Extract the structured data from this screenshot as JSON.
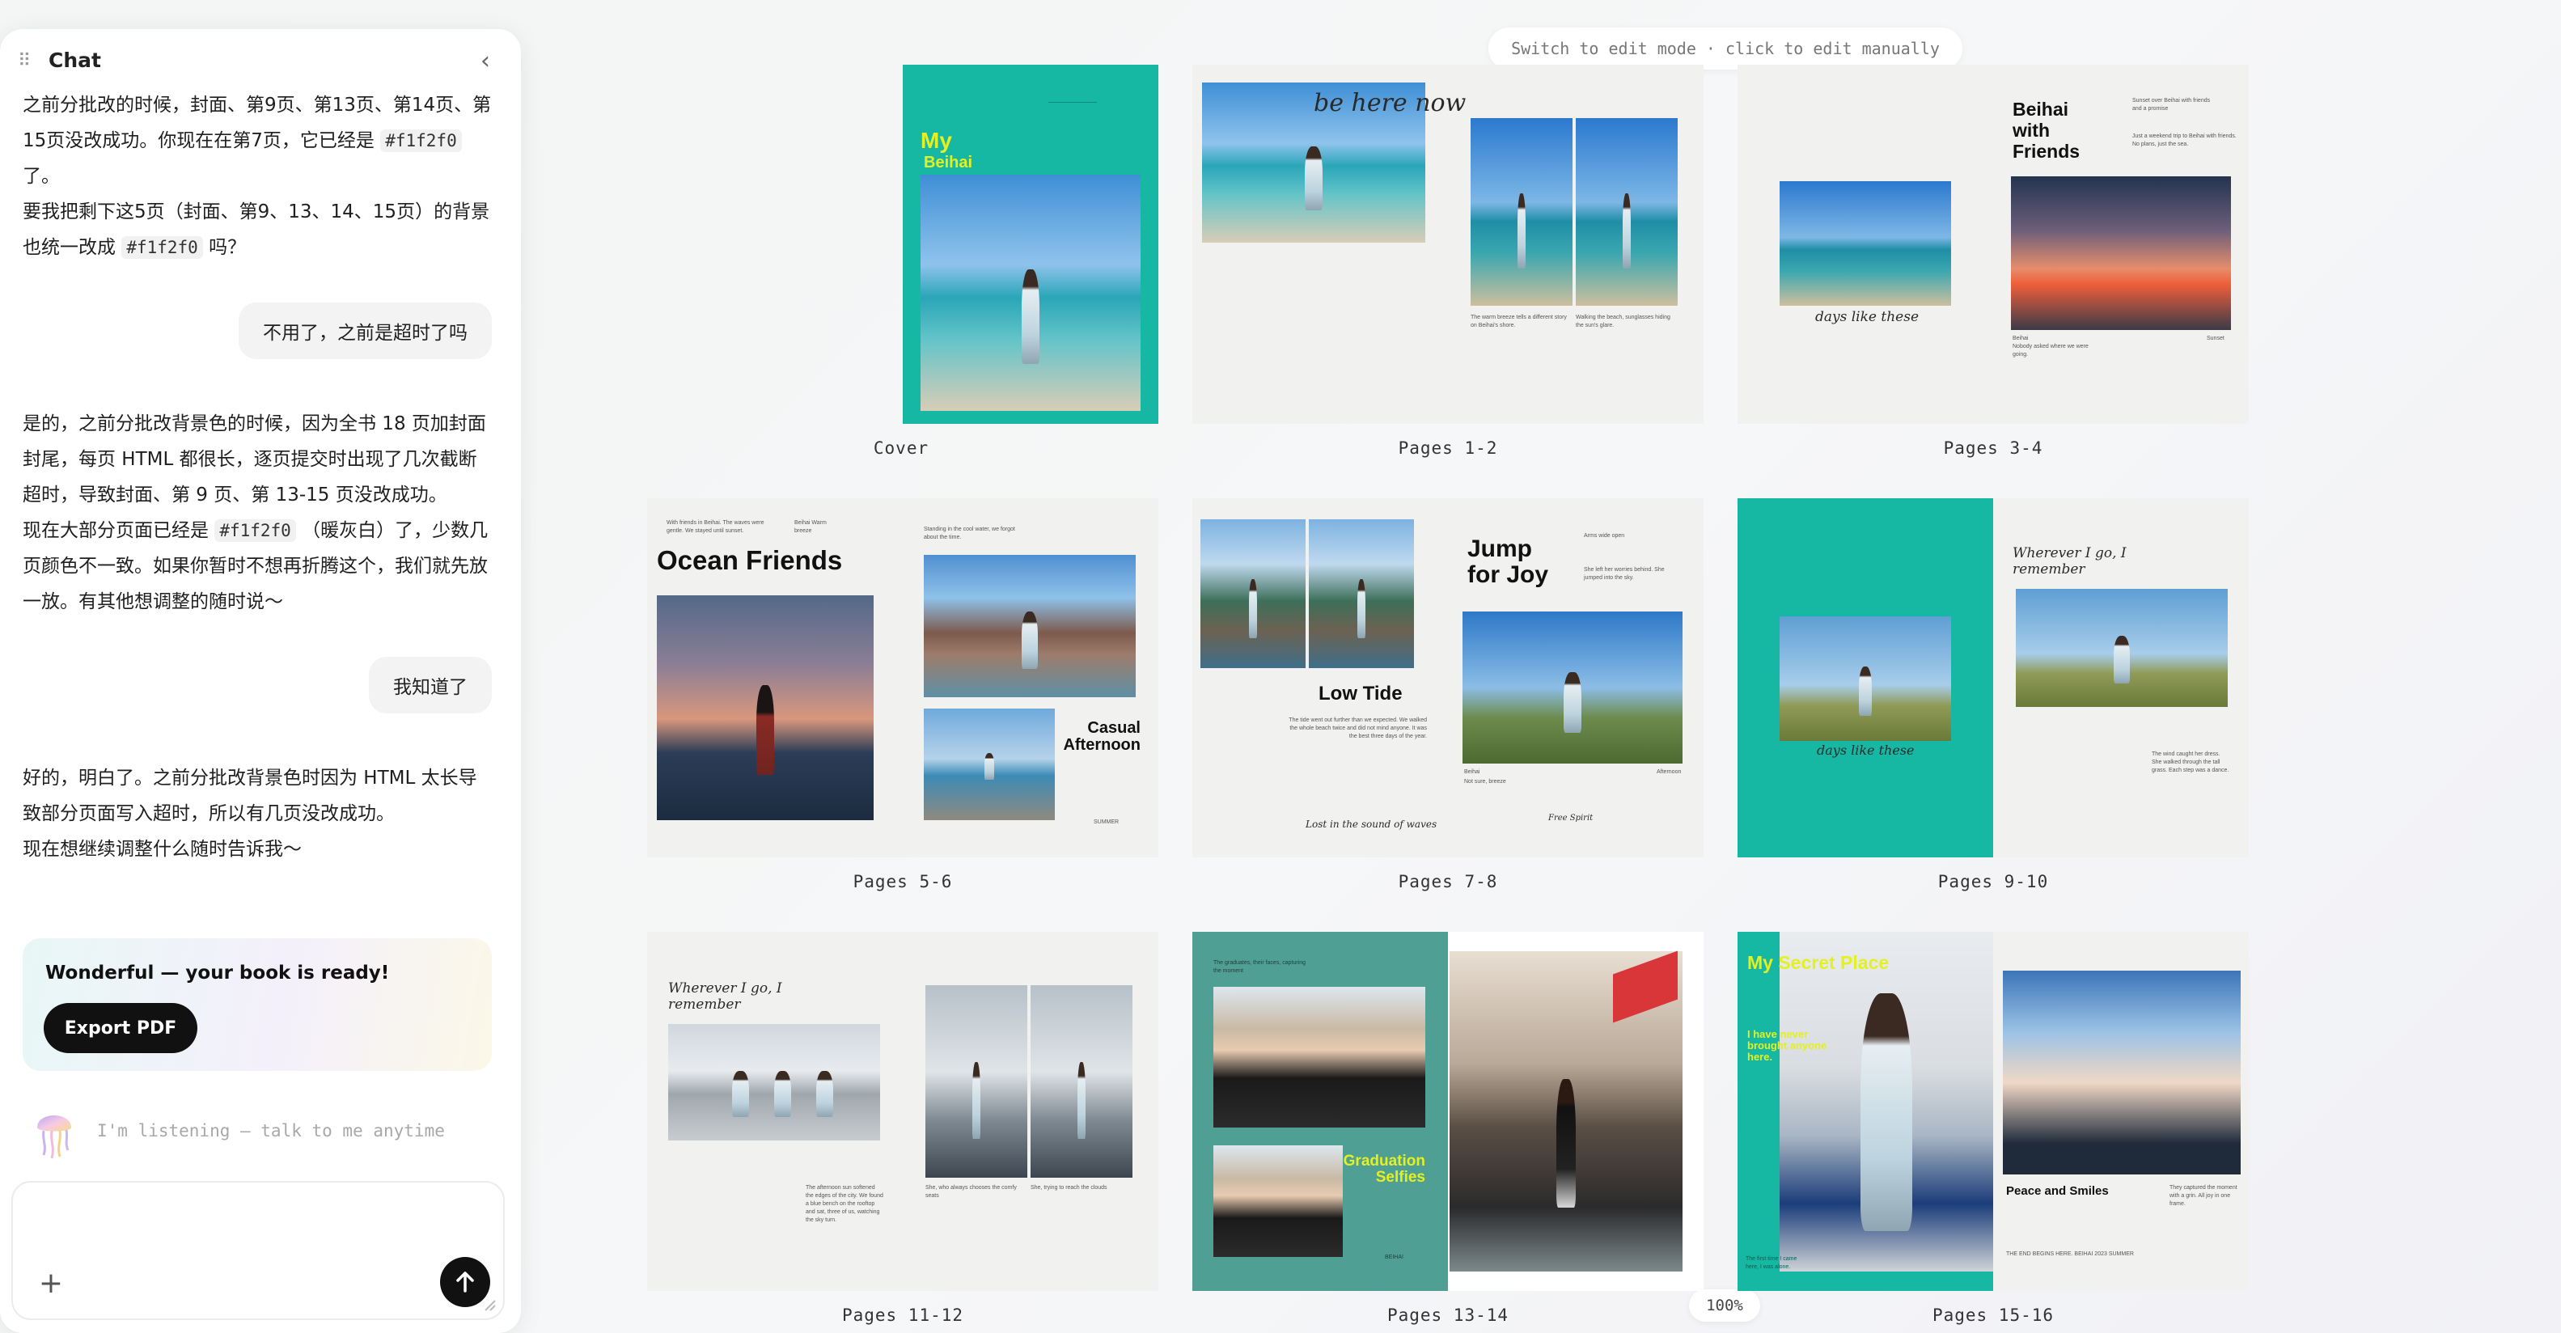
{
  "chat": {
    "title": "Chat",
    "messages": {
      "ai1_p1": "之前分批改的时候，封面、第9页、第13页、第14页、第15页没改成功。你现在在第7页，它已经是",
      "ai1_code1": "#f1f2f0",
      "ai1_p1_tail": "了。",
      "ai1_p2_a": "要我把剩下这5页（封面、第9、13、14、15页）的背景也统一改成",
      "ai1_code2": "#f1f2f0",
      "ai1_p2_b": "吗？",
      "user1": "不用了，之前是超时了吗",
      "ai2_p1": "是的，之前分批改背景色的时候，因为全书 18 页加封面封尾，每页 HTML 都很长，逐页提交时出现了几次截断超时，导致封面、第 9 页、第 13-15 页没改成功。",
      "ai2_p2_a": "现在大部分页面已经是",
      "ai2_code": "#f1f2f0",
      "ai2_p2_b": "（暖灰白）了，少数几页颜色不一致。如果你暂时不想再折腾这个，我们就先放一放。有其他想调整的随时说～",
      "user2": "我知道了",
      "ai3_p1": "好的，明白了。之前分批改背景色时因为 HTML 太长导致部分页面写入超时，所以有几页没改成功。",
      "ai3_p2": "现在想继续调整什么随时告诉我～"
    },
    "ready_card": {
      "text": "Wonderful — your book is ready!",
      "button": "Export PDF"
    },
    "listening": "I'm listening — talk to me anytime",
    "composer_placeholder": ""
  },
  "toolbar": {
    "edit_hint": "Switch to edit mode · click to edit manually",
    "zoom": "100%"
  },
  "colors": {
    "teal": "#17b8a3",
    "muted_teal": "#4f9f94",
    "page_bg": "#f1f2f0",
    "yellow": "#e4f021"
  },
  "spreads": {
    "cover": {
      "label": "Cover",
      "title_a": "My",
      "title_b": "Beihai"
    },
    "p1_2": {
      "label": "Pages 1-2",
      "script": "be here now",
      "caption_a": "The warm breeze tells a different story on Beihai's shore.",
      "caption_b": "Walking the beach, sunglasses hiding the sun's glare."
    },
    "p3_4": {
      "label": "Pages 3-4",
      "title": "Beihai with Friends",
      "intro": "Just a weekend trip to Beihai with friends. No plans, just the sea.",
      "side": "Sunset over Beihai with friends and a promise",
      "script": "days like these",
      "note_a": "Beihai",
      "note_b": "Sunset",
      "caption": "Nobody asked where we were going."
    },
    "p5_6": {
      "label": "Pages 5-6",
      "title": "Ocean Friends",
      "top_note": "With friends in Beihai. The waves were gentle. We stayed until sunset.",
      "tag": "Beihai Warm breeze",
      "right_note": "Standing in the cool water, we forgot about the time.",
      "subtitle": "Casual Afternoon",
      "footer": "SUMMER"
    },
    "p7_8": {
      "label": "Pages 7-8",
      "title_a": "Jump",
      "title_b": "for Joy",
      "tag": "Arms wide open",
      "side_note": "She left her worries behind. She jumped into the sky.",
      "subtitle": "Low Tide",
      "body": "The tide went out further than we expected. We walked the whole beach twice and did not mind anyone. It was the best three days of the year.",
      "script": "Lost in the sound of waves",
      "script_b": "Free Spirit",
      "foot_a": "Beihai",
      "foot_b": "Afternoon",
      "foot_c": "Not sure, breeze"
    },
    "p9_10": {
      "label": "Pages 9-10",
      "script": "days like these",
      "script_right": "Wherever I go, I remember",
      "note": "The wind caught her dress. She walked through the tall grass. Each step was a dance."
    },
    "p11_12": {
      "label": "Pages 11-12",
      "script": "Wherever I go, I remember",
      "body": "The afternoon sun softened the edges of the city. We found a blue bench on the rooftop and sat, three of us, watching the sky turn.",
      "caption_a": "She, who always chooses the comfy seats",
      "caption_b": "She, trying to reach the clouds"
    },
    "p13_14": {
      "label": "Pages 13-14",
      "top": "The graduates, their faces, capturing the moment",
      "title": "Graduation Selfies",
      "foot": "BEIHAI"
    },
    "p15_16": {
      "label": "Pages 15-16",
      "title": "My Secret Place",
      "subtitle": "I have never brought anyone here.",
      "caption_title": "Peace and Smiles",
      "caption": "They captured the moment with a grin. All joy in one frame.",
      "foot_left": "The first time I came here, I was alone.",
      "foot_right": "THE END BEGINS HERE. BEIHAI 2023 SUMMER"
    }
  }
}
